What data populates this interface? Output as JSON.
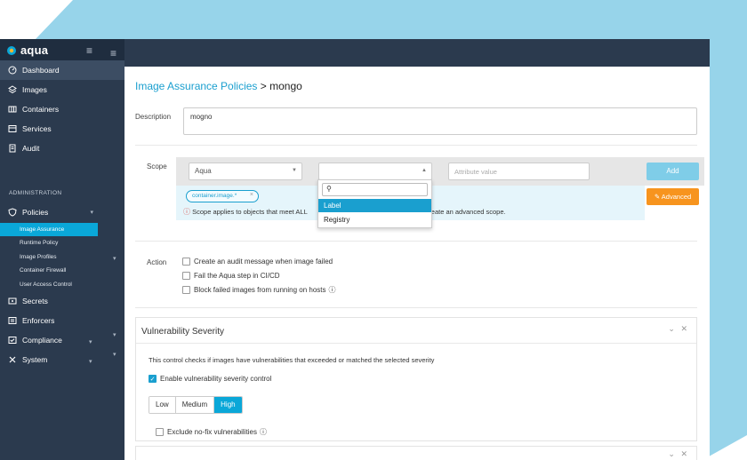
{
  "brand": {
    "name": "aqua",
    "accent": "#0aa7d8",
    "sidebar_bg": "#2b3a4e"
  },
  "sidebar": {
    "items": [
      {
        "label": "Dashboard",
        "icon": "gauge-icon"
      },
      {
        "label": "Images",
        "icon": "layers-icon"
      },
      {
        "label": "Containers",
        "icon": "container-icon"
      },
      {
        "label": "Services",
        "icon": "services-icon"
      },
      {
        "label": "Audit",
        "icon": "document-icon"
      }
    ],
    "section_label": "ADMINISTRATION",
    "policies": {
      "label": "Policies",
      "icon": "shield-icon"
    },
    "subitems": [
      {
        "label": "Image Assurance"
      },
      {
        "label": "Runtime Policy"
      },
      {
        "label": "Image Profiles"
      },
      {
        "label": "Container Firewall"
      },
      {
        "label": "User Access Control"
      }
    ],
    "bottom_items": [
      {
        "label": "Secrets",
        "icon": "key-icon"
      },
      {
        "label": "Enforcers",
        "icon": "list-icon"
      },
      {
        "label": "Compliance",
        "icon": "checklist-icon"
      },
      {
        "label": "System",
        "icon": "tools-icon"
      }
    ]
  },
  "breadcrumb": {
    "parent": "Image Assurance Policies",
    "separator": ">",
    "current": "mongo"
  },
  "description": {
    "label": "Description",
    "value": "mogno"
  },
  "scope": {
    "label": "Scope",
    "type_select": "Aqua",
    "attribute_placeholder": "Attribute value",
    "add_label": "Add",
    "tag": "container.image.*",
    "info_text_start": "Scope applies to objects that meet ALL",
    "info_text_end": "on to create an advanced scope.",
    "advanced_label": "Advanced",
    "dropdown_options": [
      "Label",
      "Registry"
    ]
  },
  "action": {
    "label": "Action",
    "options": [
      "Create an audit message when image failed",
      "Fail the Aqua step in CI/CD",
      "Block failed images from running on hosts"
    ]
  },
  "vulnerability": {
    "title": "Vulnerability Severity",
    "description": "This control checks if images have vulnerabilities that exceeded or matched the selected severity",
    "enable_label": "Enable vulnerability severity control",
    "levels": [
      "Low",
      "Medium",
      "High"
    ],
    "selected_level": "High",
    "exclude_label": "Exclude no-fix vulnerabilities"
  }
}
